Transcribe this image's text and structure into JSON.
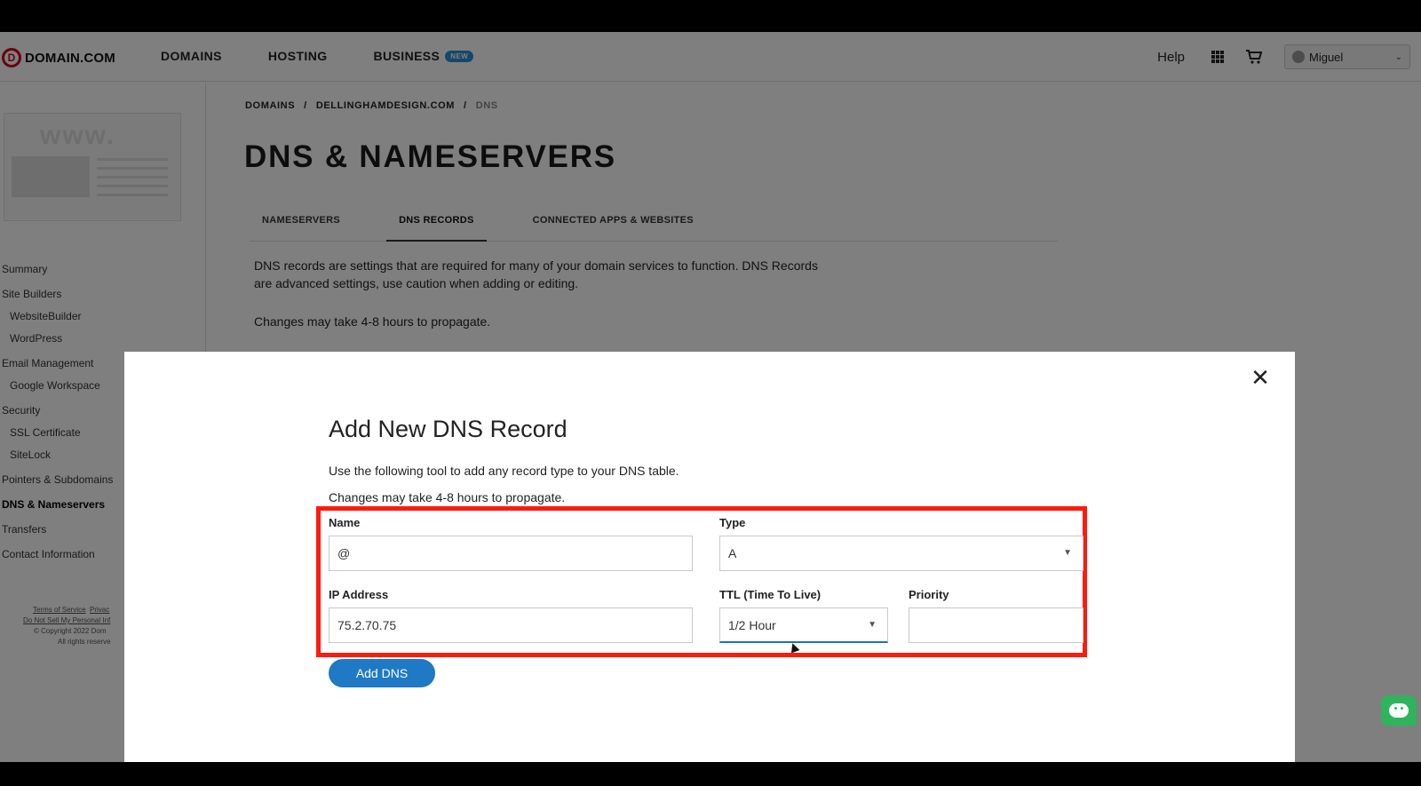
{
  "header": {
    "logo_mark": "D",
    "logo_text": "DOMAIN.COM",
    "nav": [
      {
        "label": "DOMAINS"
      },
      {
        "label": "HOSTING"
      },
      {
        "label": "BUSINESS",
        "badge": "NEW"
      }
    ],
    "help_label": "Help",
    "user_name": "Miguel"
  },
  "sidebar": {
    "thumb_text": "www.",
    "items": [
      {
        "label": "Summary"
      },
      {
        "label": "Site Builders"
      },
      {
        "label": "WebsiteBuilder"
      },
      {
        "label": "WordPress"
      },
      {
        "label": "Email Management"
      },
      {
        "label": "Google Workspace"
      },
      {
        "label": "Security"
      },
      {
        "label": "SSL Certificate"
      },
      {
        "label": "SiteLock"
      },
      {
        "label": "Pointers & Subdomains"
      },
      {
        "label": "DNS & Nameservers"
      },
      {
        "label": "Transfers"
      },
      {
        "label": "Contact Information"
      }
    ],
    "footer": {
      "terms": "Terms of Service",
      "privacy": "Privac",
      "donotsell": "Do Not Sell My Personal Inf",
      "copyright": "© Copyright 2022 Dom",
      "rights": "All rights reserve"
    }
  },
  "main": {
    "breadcrumb": [
      "DOMAINS",
      "/",
      "DELLINGHAMDESIGN.COM",
      "/",
      "DNS"
    ],
    "title": "DNS & NAMESERVERS",
    "tabs": [
      {
        "label": "NAMESERVERS"
      },
      {
        "label": "DNS RECORDS"
      },
      {
        "label": "CONNECTED APPS & WEBSITES"
      }
    ],
    "description": "DNS records are settings that are required for many of your domain services to function. DNS Records are advanced settings, use caution when adding or editing.",
    "propagate_note": "Changes may take 4-8 hours to propagate."
  },
  "modal": {
    "close_symbol": "✕",
    "title": "Add New DNS Record",
    "subtitle": "Use the following tool to add any record type to your DNS table.",
    "propagate_note": "Changes may take 4-8 hours to propagate.",
    "fields": {
      "name_label": "Name",
      "name_value": "@",
      "type_label": "Type",
      "type_value": "A",
      "ip_label": "IP Address",
      "ip_value": "75.2.70.75",
      "ttl_label": "TTL (Time To Live)",
      "ttl_value": "1/2 Hour",
      "priority_label": "Priority",
      "priority_value": ""
    },
    "add_button": "Add DNS"
  },
  "colors": {
    "brand_red": "#d0021b",
    "highlight_red": "#ff1a0d",
    "button_blue": "#1f79c4",
    "chat_green": "#2fb45b"
  }
}
